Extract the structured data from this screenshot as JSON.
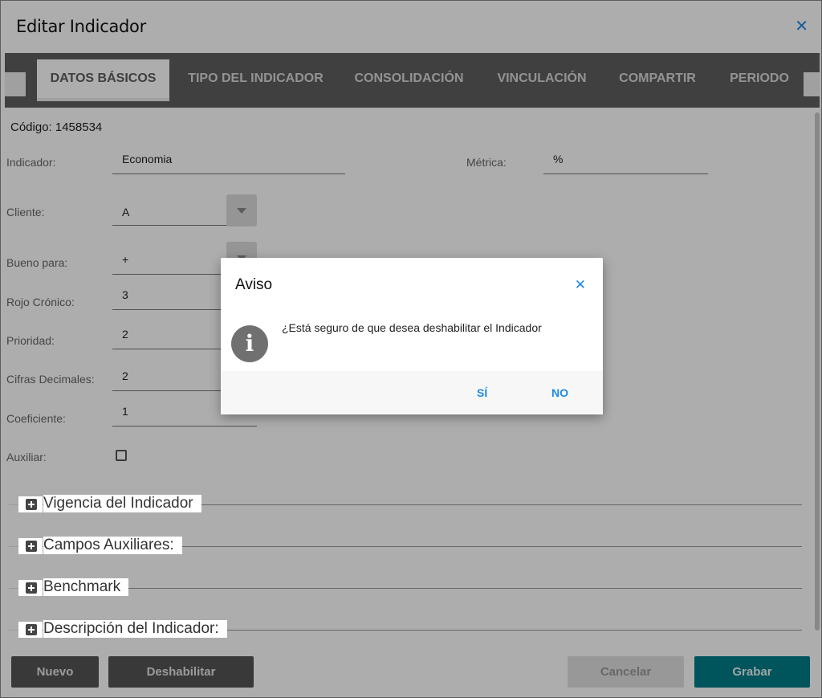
{
  "window": {
    "title": "Editar Indicador"
  },
  "tabs": [
    {
      "label": "DATOS BÁSICOS"
    },
    {
      "label": "TIPO DEL INDICADOR"
    },
    {
      "label": "CONSOLIDACIÓN"
    },
    {
      "label": "VINCULACIÓN"
    },
    {
      "label": "COMPARTIR"
    },
    {
      "label": "PERIODO"
    }
  ],
  "form": {
    "code": "Código: 1458534",
    "indicador_label": "Indicador:",
    "indicador_value": "Economia",
    "metrica_label": "Métrica:",
    "metrica_value": "%",
    "cliente_label": "Cliente:",
    "cliente_value": "A",
    "bueno_label": "Bueno para:",
    "bueno_value": "+",
    "rojo_label": "Rojo Crónico:",
    "rojo_value": "3",
    "prioridad_label": "Prioridad:",
    "prioridad_value": "2",
    "cifras_label": "Cifras Decimales:",
    "cifras_value": "2",
    "coef_label": "Coeficiente:",
    "coef_value": "1",
    "auxiliar_label": "Auxiliar:",
    "auxiliar_checked": false
  },
  "sections": [
    {
      "title": "Vigencia del Indicador"
    },
    {
      "title": "Campos Auxiliares:"
    },
    {
      "title": "Benchmark"
    },
    {
      "title": "Descripción del Indicador:"
    }
  ],
  "footer": {
    "nuevo": "Nuevo",
    "deshabilitar": "Deshabilitar",
    "cancelar": "Cancelar",
    "grabar": "Grabar"
  },
  "dialog": {
    "title": "Aviso",
    "icon": "info-icon",
    "message": "¿Está seguro de que desea deshabilitar el Indicador",
    "yes": "SÍ",
    "no": "NO"
  },
  "colors": {
    "accent": "#1e88e5",
    "primary_button": "#007d86",
    "tab_bar": "#5f5f5f"
  }
}
